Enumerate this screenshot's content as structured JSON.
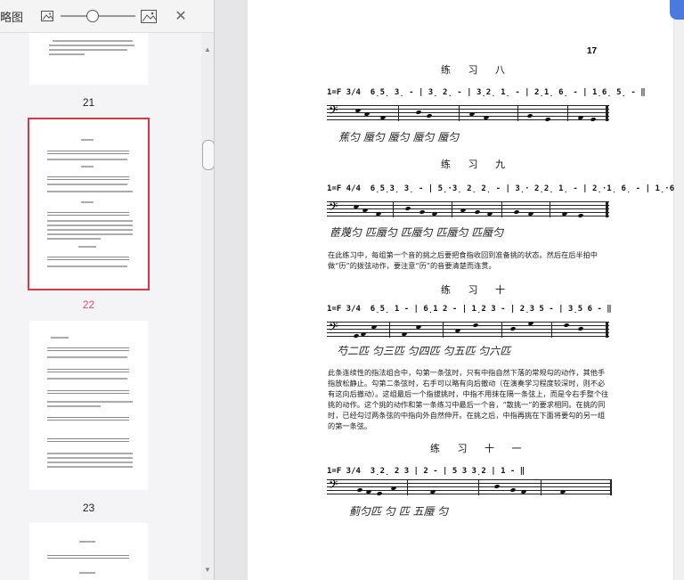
{
  "toolbar": {
    "title": "略图",
    "icons": [
      "image-small-icon",
      "image-large-icon",
      "close-icon"
    ],
    "zoom_fraction": 0.42
  },
  "thumbnails": [
    {
      "label": "21",
      "selected": false
    },
    {
      "label": "22",
      "selected": true
    },
    {
      "label": "23",
      "selected": false
    }
  ],
  "page": {
    "number": "17",
    "ex8_title": "练 习 八",
    "ex8_notes": "1=F 3/4  6̣5̣ 3̣ - | 3̣ 2̣ - | 3̣2̣ 1̣ - | 2̣1̣ 6̣ - | 1̣6̣ 5̣ - ‖",
    "ex8_fing": "蕉匀  蜃匀  蜃匀  蜃匀  蜃匀",
    "ex9_title": "练 习 九",
    "ex9_notes": "1=F 4/4  6̣5̣3̣ 3̣ - | 5̣·3̣ 2̣ 2̣ - | 3̣· 2̣2̣ 1̣ - | 2̣·1̣ 6̣ - | 1̣·6̣ 5̣ - ‖",
    "ex9_fing": "茞蔑匀  匹蜃匀  匹蜃匀  匹蜃匀  匹蜃匀",
    "para1": "在此练习中，每组第一个音的挑之后要把食指收回到准备挑的状态。然后在后半拍中做“历”的拨弦动作，要注意“历”的音要清楚而连贯。",
    "ex10_title": "练 习 十",
    "ex10_notes": "1=F 3/4  6̣5̣ 1 - | 6̣1 2 - | 1̣2 3 - | 2̣3 5 - | 3̣5 6 - ‖",
    "ex10_fing": "芍二匹  匀三匹  匀四匹  匀五匹  匀六匹",
    "para2": "此条连续性的指法组合中，勾第一条弦时，只有中指自然下落的常规勾的动作，其他手指放松静止。勾第二条弦时，右手可以略有向后撤动（在演奏学习程度较深时，则不必有这向后撤动）。这组最后一个指拔挑时，中指不用抹在隔一条弦上，而是令右手整个往挑的动作。这个挑的动作和第一条练习中最后一个音，“散挑一”的要求相同。在挑的同时，已经勾过两条弦的中指向外自然伸开。在挑之后，中指再挑在下面将要勾的另一组的第一条弦。",
    "ex11_title": "练 习 十 一",
    "ex11_notes": "1=F 3/4  3̣2̣ 2 3 | 2 - | 5 3 3̣2 | 1 - ‖",
    "ex11_fing": "蓟匀匹  匀    匹 五蜃  匀"
  }
}
